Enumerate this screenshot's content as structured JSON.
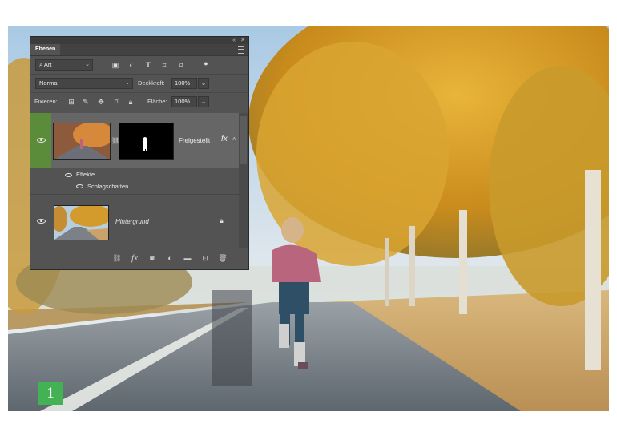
{
  "step": {
    "number": "1"
  },
  "panel": {
    "tab": "Ebenen",
    "filter": {
      "label": "Art"
    },
    "blend_mode": "Normal",
    "opacity_label": "Deckkraft:",
    "opacity_value": "100%",
    "lock_label": "Fixieren:",
    "fill_label": "Fläche:",
    "fill_value": "100%",
    "layers": [
      {
        "name": "Freigestellt",
        "fx": "fx",
        "selected": true,
        "effects_label": "Effekte",
        "effect_items": [
          "Schlagschatten"
        ]
      },
      {
        "name": "Hintergrund",
        "locked": true
      }
    ],
    "footer_icons": [
      "link-icon",
      "fx-icon",
      "mask-icon",
      "adjustment-icon",
      "group-folder-icon",
      "new-layer-icon",
      "trash-icon"
    ]
  },
  "colors": {
    "selection_accent": "#5b8c3a",
    "badge": "#43b255"
  }
}
